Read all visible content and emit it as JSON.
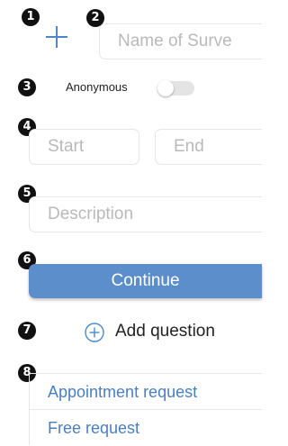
{
  "badges": [
    "1",
    "2",
    "3",
    "4",
    "5",
    "6",
    "7",
    "8"
  ],
  "survey": {
    "name_placeholder": "Name of Surve",
    "anonymous_label": "Anonymous",
    "anonymous_enabled": false,
    "start_placeholder": "Start",
    "end_placeholder": "End",
    "description_placeholder": "Description",
    "continue_label": "Continue",
    "add_question_label": "Add question"
  },
  "request_types": [
    "Appointment request",
    "Free request"
  ],
  "colors": {
    "accent": "#4a89c9",
    "button": "#5b8ecb",
    "link": "#4a7fbf",
    "border": "#e6e6e6",
    "placeholder": "#b9b9b9",
    "badge": "#111111"
  },
  "icons": {
    "add": "plus-icon",
    "add_question": "plus-circle-icon"
  }
}
